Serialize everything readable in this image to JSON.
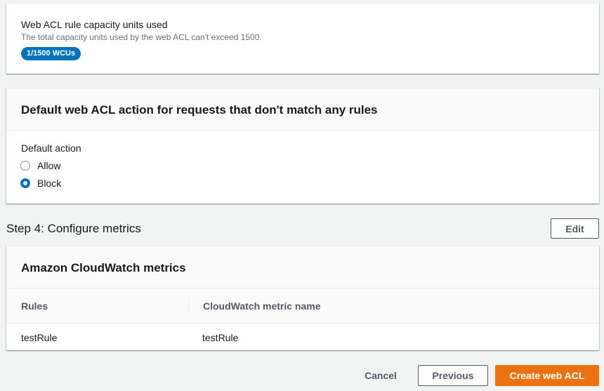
{
  "capacity": {
    "title": "Web ACL rule capacity units used",
    "description": "The total capacity units used by the web ACL can't exceed 1500.",
    "badge": "1/1500 WCUs"
  },
  "default_action": {
    "header": "Default web ACL action for requests that don't match any rules",
    "label": "Default action",
    "options": [
      {
        "label": "Allow",
        "checked": false
      },
      {
        "label": "Block",
        "checked": true
      }
    ]
  },
  "step4": {
    "title": "Step 4: Configure metrics",
    "edit_label": "Edit"
  },
  "metrics": {
    "header": "Amazon CloudWatch metrics",
    "columns": [
      "Rules",
      "CloudWatch metric name"
    ],
    "rows": [
      {
        "rule": "testRule",
        "metric_name": "testRule"
      }
    ]
  },
  "footer": {
    "cancel_label": "Cancel",
    "previous_label": "Previous",
    "create_label": "Create web ACL"
  },
  "colors": {
    "accent_blue": "#0073bb",
    "primary_orange": "#ec7211"
  }
}
